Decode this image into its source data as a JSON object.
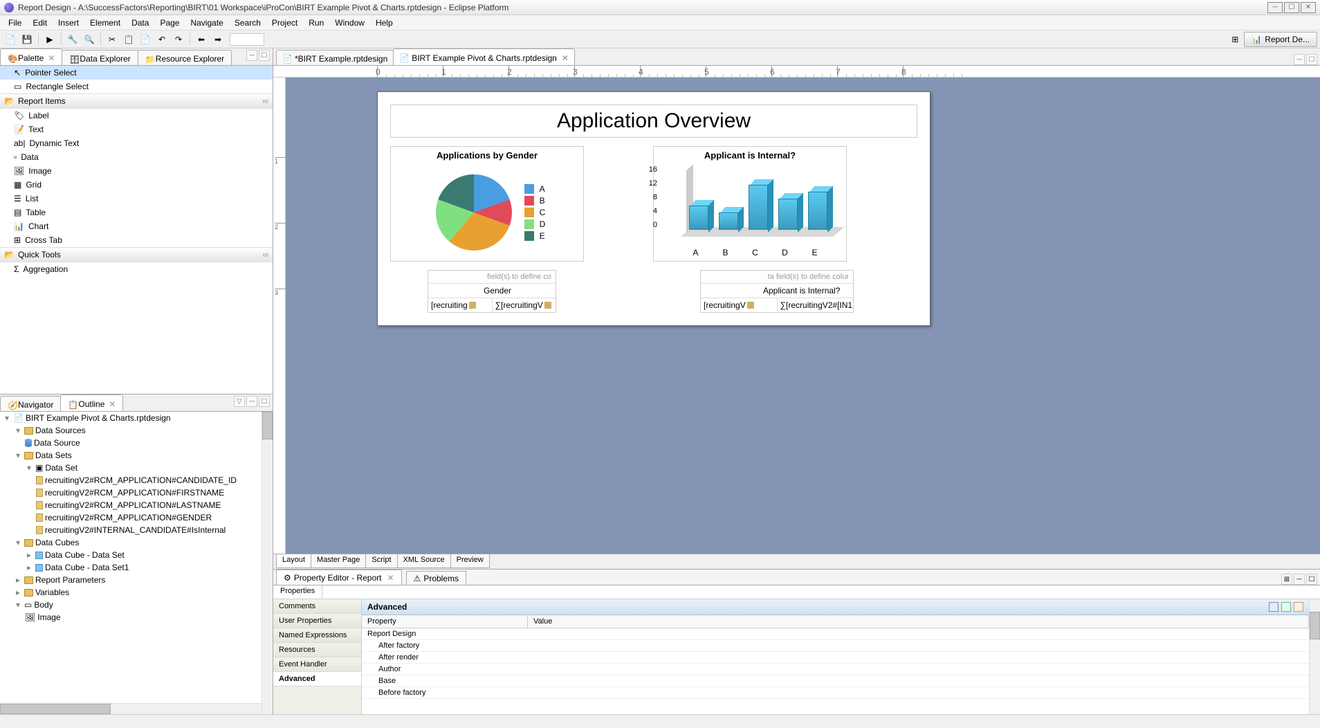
{
  "window": {
    "title": "Report Design - A:\\SuccessFactors\\Reporting\\BIRT\\01 Workspace\\iProCon\\BIRT Example Pivot & Charts.rptdesign - Eclipse Platform"
  },
  "menu": [
    "File",
    "Edit",
    "Insert",
    "Element",
    "Data",
    "Page",
    "Navigate",
    "Search",
    "Project",
    "Run",
    "Window",
    "Help"
  ],
  "perspective": "Report De...",
  "left_top_tabs": [
    {
      "label": "Palette",
      "active": true
    },
    {
      "label": "Data Explorer",
      "active": false
    },
    {
      "label": "Resource Explorer",
      "active": false
    }
  ],
  "palette": {
    "select_items": [
      "Pointer Select",
      "Rectangle Select"
    ],
    "selected": "Pointer Select",
    "report_items_header": "Report Items",
    "report_items": [
      "Label",
      "Text",
      "Dynamic Text",
      "Data",
      "Image",
      "Grid",
      "List",
      "Table",
      "Chart",
      "Cross Tab"
    ],
    "quick_tools_header": "Quick Tools",
    "quick_tools": [
      "Aggregation"
    ]
  },
  "left_bottom_tabs": [
    {
      "label": "Navigator",
      "active": false
    },
    {
      "label": "Outline",
      "active": true
    }
  ],
  "outline": {
    "root": "BIRT Example Pivot & Charts.rptdesign",
    "data_sources": {
      "label": "Data Sources",
      "items": [
        "Data Source"
      ]
    },
    "data_sets": {
      "label": "Data Sets",
      "set_name": "Data Set",
      "columns": [
        "recruitingV2#RCM_APPLICATION#CANDIDATE_ID",
        "recruitingV2#RCM_APPLICATION#FIRSTNAME",
        "recruitingV2#RCM_APPLICATION#LASTNAME",
        "recruitingV2#RCM_APPLICATION#GENDER",
        "recruitingV2#INTERNAL_CANDIDATE#IsInternal"
      ]
    },
    "data_cubes": {
      "label": "Data Cubes",
      "items": [
        "Data Cube - Data Set",
        "Data Cube - Data Set1"
      ]
    },
    "report_parameters": "Report Parameters",
    "variables": "Variables",
    "body": {
      "label": "Body",
      "items": [
        "Image"
      ]
    }
  },
  "editor_tabs": [
    {
      "label": "*BIRT Example.rptdesign",
      "active": false
    },
    {
      "label": "BIRT Example Pivot & Charts.rptdesign",
      "active": true
    }
  ],
  "ruler_marks": [
    "0",
    "1",
    "2",
    "3",
    "4",
    "5",
    "6",
    "7",
    "8"
  ],
  "vruler_marks": [
    "1",
    "2",
    "3"
  ],
  "report": {
    "title": "Application Overview",
    "chart1": {
      "title": "Applications by Gender",
      "legend": [
        {
          "label": "A",
          "color": "#4a9de0"
        },
        {
          "label": "B",
          "color": "#e04a5a"
        },
        {
          "label": "C",
          "color": "#e8a030"
        },
        {
          "label": "D",
          "color": "#80e080"
        },
        {
          "label": "E",
          "color": "#3a7a70"
        }
      ]
    },
    "chart2": {
      "title": "Applicant is Internal?",
      "yticks": [
        "16",
        "12",
        "8",
        "4",
        "0"
      ],
      "bars": [
        {
          "label": "A",
          "h": 7
        },
        {
          "label": "B",
          "h": 5
        },
        {
          "label": "C",
          "h": 13
        },
        {
          "label": "D",
          "h": 9
        },
        {
          "label": "E",
          "h": 11
        }
      ]
    },
    "table1": {
      "hint": "field(s) to define co",
      "header": "Gender",
      "cells": [
        "[recruiting",
        "∑[recruitingV"
      ]
    },
    "table2": {
      "hint": "ta field(s) to define colur",
      "header": "Applicant is Internal?",
      "cells": [
        "[recruitingV",
        "∑[recruitingV2#[IN1"
      ]
    }
  },
  "chart_data": [
    {
      "type": "pie",
      "title": "Applications by Gender",
      "categories": [
        "A",
        "B",
        "C",
        "D",
        "E"
      ],
      "values": [
        19,
        11,
        31,
        19,
        20
      ],
      "colors": [
        "#4a9de0",
        "#e04a5a",
        "#e8a030",
        "#80e080",
        "#3a7a70"
      ]
    },
    {
      "type": "bar",
      "title": "Applicant is Internal?",
      "categories": [
        "A",
        "B",
        "C",
        "D",
        "E"
      ],
      "values": [
        7,
        5,
        13,
        9,
        11
      ],
      "ylim": [
        0,
        16
      ],
      "yticks": [
        0,
        4,
        8,
        12,
        16
      ]
    }
  ],
  "bottom_tabs": [
    "Layout",
    "Master Page",
    "Script",
    "XML Source",
    "Preview"
  ],
  "bottom_tabs_active": "Layout",
  "prop_tabs": [
    {
      "label": "Property Editor - Report",
      "active": true
    },
    {
      "label": "Problems",
      "active": false
    }
  ],
  "prop_subtab": "Properties",
  "prop_cats": [
    "Comments",
    "User Properties",
    "Named Expressions",
    "Resources",
    "Event Handler",
    "Advanced"
  ],
  "prop_cats_active": "Advanced",
  "prop_grid": {
    "title": "Advanced",
    "col1": "Property",
    "col2": "Value",
    "rows": [
      {
        "name": "Report Design",
        "indent": 0
      },
      {
        "name": "After factory",
        "indent": 1
      },
      {
        "name": "After render",
        "indent": 1
      },
      {
        "name": "Author",
        "indent": 1
      },
      {
        "name": "Base",
        "indent": 1
      },
      {
        "name": "Before factory",
        "indent": 1
      }
    ]
  }
}
